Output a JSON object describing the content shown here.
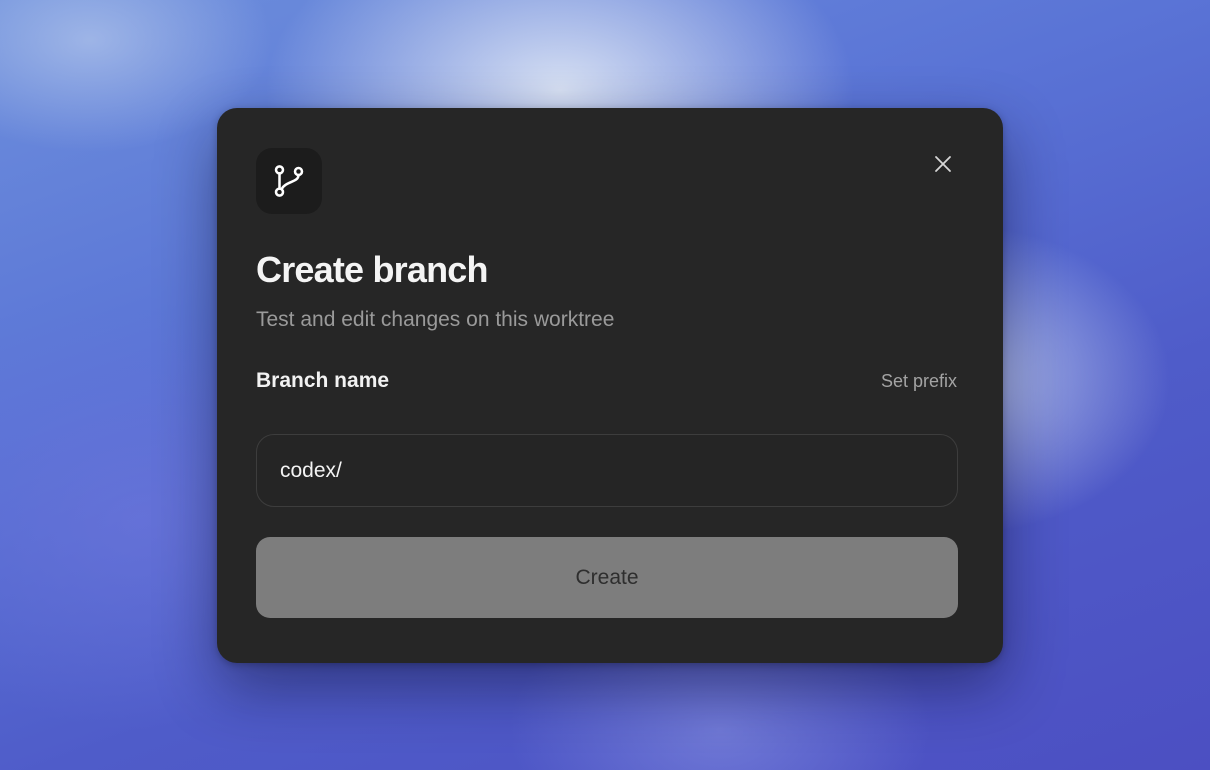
{
  "dialog": {
    "title": "Create branch",
    "subtitle": "Test and edit changes on this worktree",
    "header_icon": "git-branch-icon",
    "close_icon": "close-icon"
  },
  "form": {
    "branch_label": "Branch name",
    "set_prefix_label": "Set prefix",
    "branch_value": "codex/",
    "submit_label": "Create"
  },
  "colors": {
    "dialog_background": "#262626",
    "submit_background": "#7d7d7d",
    "desktop_accent": "#5a74d6"
  }
}
